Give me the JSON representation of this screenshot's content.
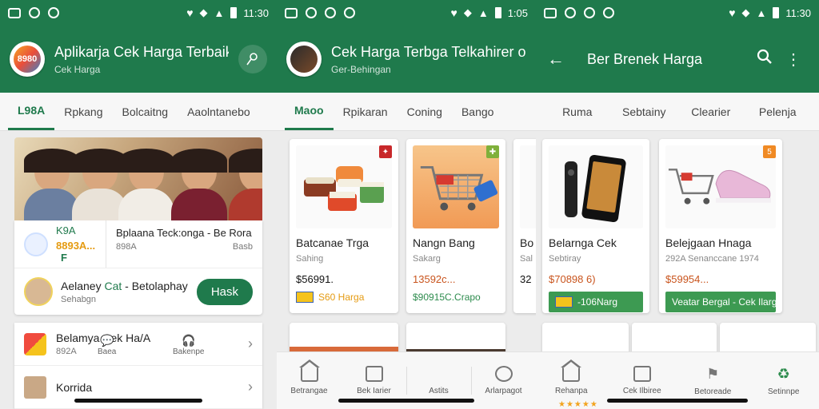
{
  "colors": {
    "primary": "#1f7a4c",
    "accent": "#e59b12",
    "button_green": "#3d9a52"
  },
  "screen1": {
    "status_time": "11:30",
    "app_title": "Aplikarja Cek Harga Terbaik",
    "app_subtitle": "Cek Harga",
    "logo_text": "8980",
    "action_icon": "user-icon",
    "tabs": [
      "L98A",
      "Rpkang",
      "Bolcaitng",
      "Aaolntanebo"
    ],
    "promo": {
      "left_title": "K9A",
      "left_price": "8893A...",
      "left_flag": "F",
      "right_title": "Bplaana Teck:onga - Be Rora",
      "right_sub": "898A",
      "right_extra": "Basb"
    },
    "hack": {
      "title_a": "Aelaney ",
      "title_b": "Cat",
      "title_c": " - Betolaphay",
      "sub": "Sehabgn",
      "button": "Hask"
    },
    "list": [
      {
        "title": "Belamya Cek Ha/A",
        "sub": "892A",
        "extra1": "Baea",
        "extra2": "Bakenpe"
      },
      {
        "title": "Korrida",
        "sub": ""
      }
    ]
  },
  "screen2": {
    "status_time": "1:05",
    "app_title": "Cek Harga Terbga Telkahirer ock",
    "app_subtitle": "Ger-Behingan",
    "tabs": [
      "Maoo",
      "Rpikaran",
      "Coning",
      "Bango"
    ],
    "products": [
      {
        "name": "Batcanae Trga",
        "sub": "Sahing",
        "price": "$56991.",
        "tag": "S60 Harga",
        "badge": "ribbon-icon"
      },
      {
        "name": "Nangn Bang",
        "sub": "Sakarg",
        "price": "13592c...",
        "tag": "$90915C.Crapo",
        "badge": "tag-icon"
      },
      {
        "name": "Bo",
        "sub": "Sal",
        "price": "32",
        "tag": "",
        "badge": ""
      }
    ],
    "nav": [
      "Betrangae",
      "Bek Iarier",
      "Astits",
      "Arlarpagot"
    ]
  },
  "screen3": {
    "status_time": "11:30",
    "title": "Ber Brenek Harga",
    "tabs": [
      "Ruma",
      "Sebtainy",
      "Clearier",
      "Pelenja"
    ],
    "products": [
      {
        "name": "Belarnga Cek",
        "sub": "Sebtiray",
        "price": "$70898 6)",
        "tag": "-106Narg",
        "badge": ""
      },
      {
        "name": "Belejgaan Hnaga",
        "sub": "292A Senanccane 1974",
        "price": "$59954...",
        "tag": "Veatar Bergal - Cek Ilarga",
        "badge": "5"
      }
    ],
    "nav": [
      "Rehanpa",
      "Cek Ilbiree",
      "Betoreade",
      "Setinnpe"
    ],
    "stars": "★★★★★"
  }
}
